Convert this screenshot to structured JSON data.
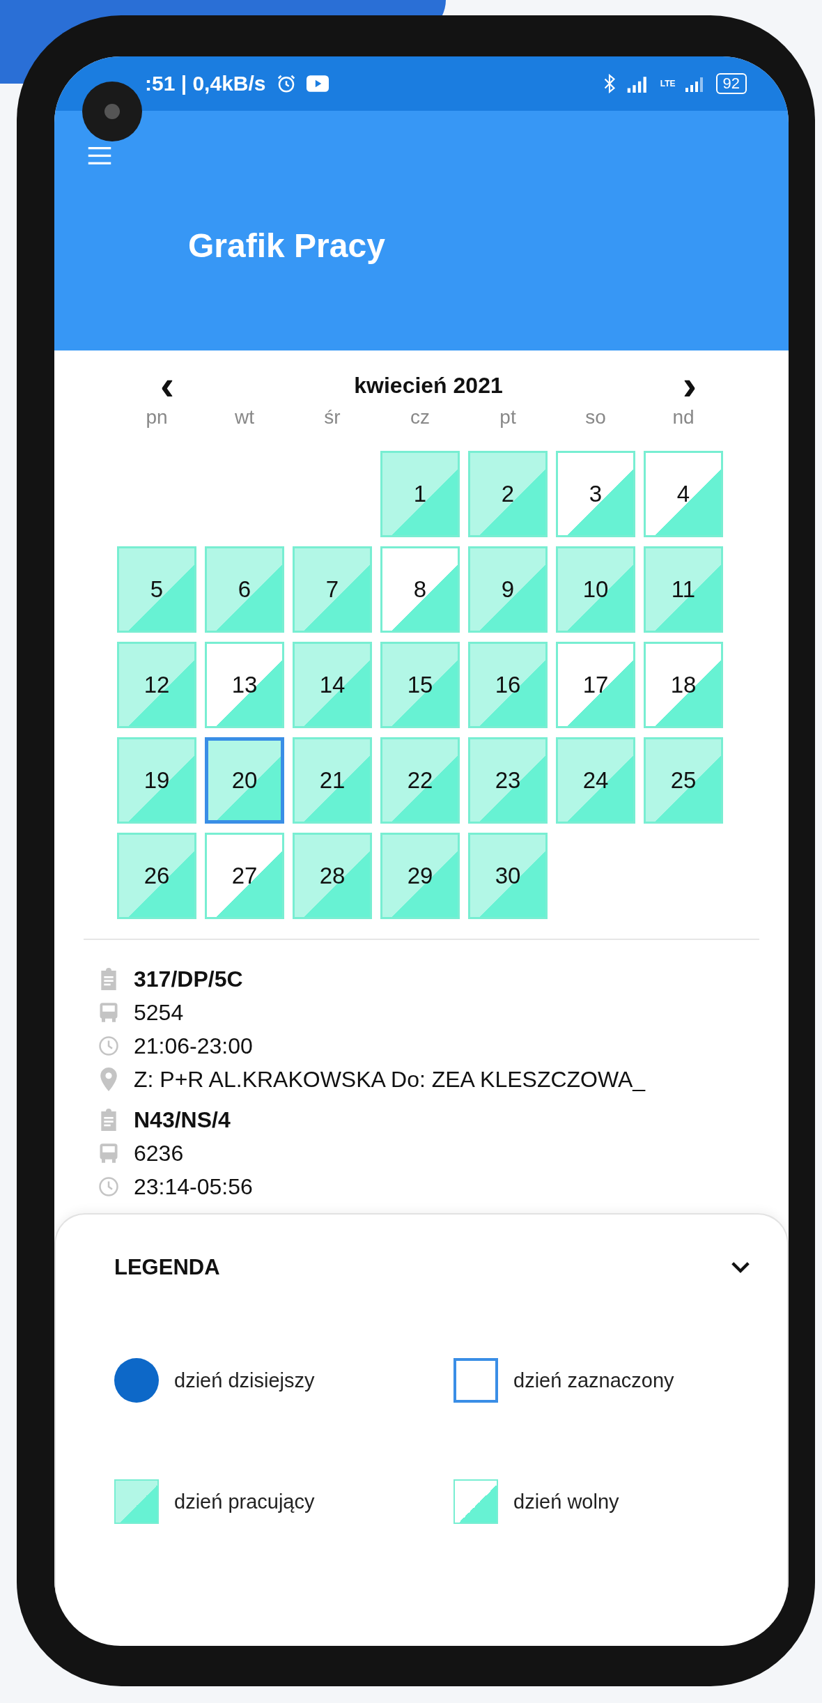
{
  "status_bar": {
    "time_speed": ":51 | 0,4kB/s",
    "network": "LTE",
    "battery": "92"
  },
  "header": {
    "title": "Grafik Pracy"
  },
  "calendar": {
    "month": "kwiecień 2021",
    "prev": "‹",
    "next": "›",
    "weekdays": [
      "pn",
      "wt",
      "śr",
      "cz",
      "pt",
      "so",
      "nd"
    ],
    "days": [
      {
        "label": "1",
        "kind": "work",
        "selected": false
      },
      {
        "label": "2",
        "kind": "work",
        "selected": false
      },
      {
        "label": "3",
        "kind": "free",
        "selected": false
      },
      {
        "label": "4",
        "kind": "free",
        "selected": false
      },
      {
        "label": "5",
        "kind": "work",
        "selected": false
      },
      {
        "label": "6",
        "kind": "work",
        "selected": false
      },
      {
        "label": "7",
        "kind": "work",
        "selected": false
      },
      {
        "label": "8",
        "kind": "free",
        "selected": false
      },
      {
        "label": "9",
        "kind": "work",
        "selected": false
      },
      {
        "label": "10",
        "kind": "work",
        "selected": false
      },
      {
        "label": "11",
        "kind": "work",
        "selected": false
      },
      {
        "label": "12",
        "kind": "work",
        "selected": false
      },
      {
        "label": "13",
        "kind": "free",
        "selected": false
      },
      {
        "label": "14",
        "kind": "work",
        "selected": false
      },
      {
        "label": "15",
        "kind": "work",
        "selected": false
      },
      {
        "label": "16",
        "kind": "work",
        "selected": false
      },
      {
        "label": "17",
        "kind": "free",
        "selected": false
      },
      {
        "label": "18",
        "kind": "free",
        "selected": false
      },
      {
        "label": "19",
        "kind": "work",
        "selected": false
      },
      {
        "label": "20",
        "kind": "work",
        "selected": true
      },
      {
        "label": "21",
        "kind": "work",
        "selected": false
      },
      {
        "label": "22",
        "kind": "work",
        "selected": false
      },
      {
        "label": "23",
        "kind": "work",
        "selected": false
      },
      {
        "label": "24",
        "kind": "work",
        "selected": false
      },
      {
        "label": "25",
        "kind": "work",
        "selected": false
      },
      {
        "label": "26",
        "kind": "work",
        "selected": false
      },
      {
        "label": "27",
        "kind": "free",
        "selected": false
      },
      {
        "label": "28",
        "kind": "work",
        "selected": false
      },
      {
        "label": "29",
        "kind": "work",
        "selected": false
      },
      {
        "label": "30",
        "kind": "work",
        "selected": false
      }
    ]
  },
  "details": [
    {
      "kind": "route",
      "text": "317/DP/5C"
    },
    {
      "kind": "vehicle",
      "text": "5254"
    },
    {
      "kind": "time",
      "text": "21:06-23:00"
    },
    {
      "kind": "place",
      "text": "Z: P+R AL.KRAKOWSKA Do: ZEA KLESZCZOWA_"
    },
    {
      "kind": "route",
      "text": "N43/NS/4"
    },
    {
      "kind": "vehicle",
      "text": "6236"
    },
    {
      "kind": "time",
      "text": "23:14-05:56"
    }
  ],
  "legend": {
    "title": "LEGENDA",
    "expanded": true,
    "items": [
      {
        "kind": "today",
        "label": "dzień dzisiejszy"
      },
      {
        "kind": "selected",
        "label": "dzień zaznaczony"
      },
      {
        "kind": "work",
        "label": "dzień pracujący"
      },
      {
        "kind": "free",
        "label": "dzień wolny"
      }
    ]
  }
}
